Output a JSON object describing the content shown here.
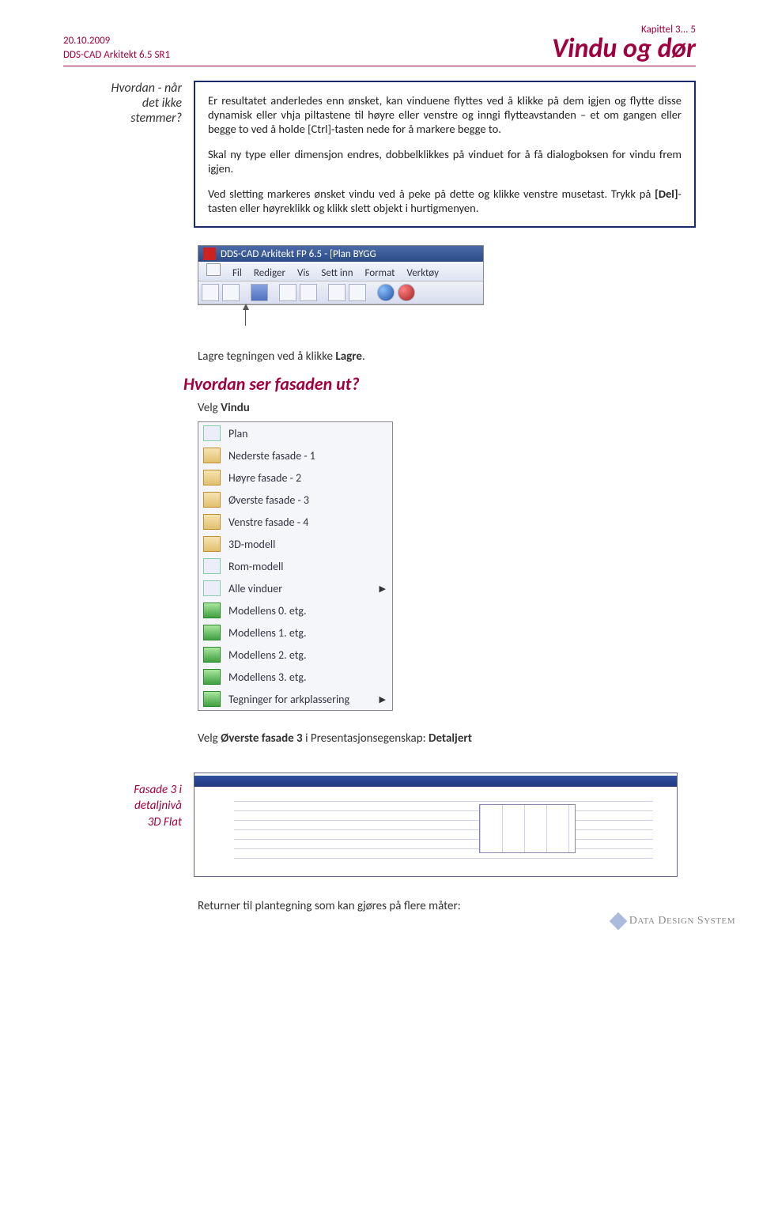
{
  "header": {
    "date": "20.10.2009",
    "product": "DDS-CAD Arkitekt 6.5 SR1",
    "chapter": "Kapittel 3... 5",
    "title": "Vindu og dør"
  },
  "marginNote": {
    "line1": "Hvordan - når",
    "line2": "det ikke",
    "line3": "stemmer?"
  },
  "infoBox": {
    "p1": "Er resultatet anderledes enn ønsket, kan vinduene flyttes ved å klikke på dem igjen og flytte disse dynamisk eller vhja piltastene til høyre eller venstre og inngi flytteavstanden – et om gangen eller begge to ved å holde [Ctrl]-tasten nede for å markere begge to.",
    "p2": "Skal ny type eller dimensjon endres, dobbelklikkes på vinduet for å få dialogboksen for vindu frem igjen.",
    "p3a": "Ved sletting markeres ønsket vindu ved å peke på dette og klikke venstre musetast. Trykk på ",
    "p3bold": "[Del]",
    "p3b": "-tasten eller høyreklikk og klikk slett objekt i hurtigmenyen."
  },
  "appWindow": {
    "title": "DDS-CAD Arkitekt FP 6.5 - [Plan  BYGG",
    "menu": {
      "fil": "Fil",
      "rediger": "Rediger",
      "vis": "Vis",
      "settinn": "Sett inn",
      "format": "Format",
      "verktoy": "Verktøy"
    }
  },
  "caption1a": "Lagre tegningen ved å klikke ",
  "caption1b": "Lagre",
  "caption1c": ".",
  "subhead": "Hvordan ser fasaden ut?",
  "velgLabel": "Velg ",
  "velgBold": "Vindu",
  "viewItems": [
    {
      "label": "Plan",
      "iconClass": "grid",
      "arrow": false
    },
    {
      "label": "Nederste fasade - 1",
      "iconClass": "house",
      "arrow": false
    },
    {
      "label": "Høyre fasade - 2",
      "iconClass": "house",
      "arrow": false
    },
    {
      "label": "Øverste fasade - 3",
      "iconClass": "house",
      "arrow": false
    },
    {
      "label": "Venstre fasade - 4",
      "iconClass": "house",
      "arrow": false
    },
    {
      "label": "3D-modell",
      "iconClass": "house",
      "arrow": false
    },
    {
      "label": "Rom-modell",
      "iconClass": "grid",
      "arrow": false
    },
    {
      "label": "Alle vinduer",
      "iconClass": "grid",
      "arrow": true
    },
    {
      "label": "Modellens 0. etg.",
      "iconClass": "green",
      "arrow": false
    },
    {
      "label": "Modellens 1. etg.",
      "iconClass": "green",
      "arrow": false
    },
    {
      "label": "Modellens 2. etg.",
      "iconClass": "green",
      "arrow": false
    },
    {
      "label": "Modellens 3. etg.",
      "iconClass": "green",
      "arrow": false
    },
    {
      "label": "Tegninger for arkplassering",
      "iconClass": "green",
      "arrow": true
    }
  ],
  "detailLinea": "Velg ",
  "detailLineBold": "Øverste fasade 3",
  "detailLineb": " i Presentasjonsegenskap: ",
  "detailLineBold2": "Detaljert",
  "facadeMargin": {
    "l1": "Fasade 3 i",
    "l2": "detaljnivå",
    "l3": "3D Flat"
  },
  "returnLine": "Returner til plantegning som kan gjøres på flere måter:",
  "footerLogo": "DATA DESIGN SYSTEM"
}
